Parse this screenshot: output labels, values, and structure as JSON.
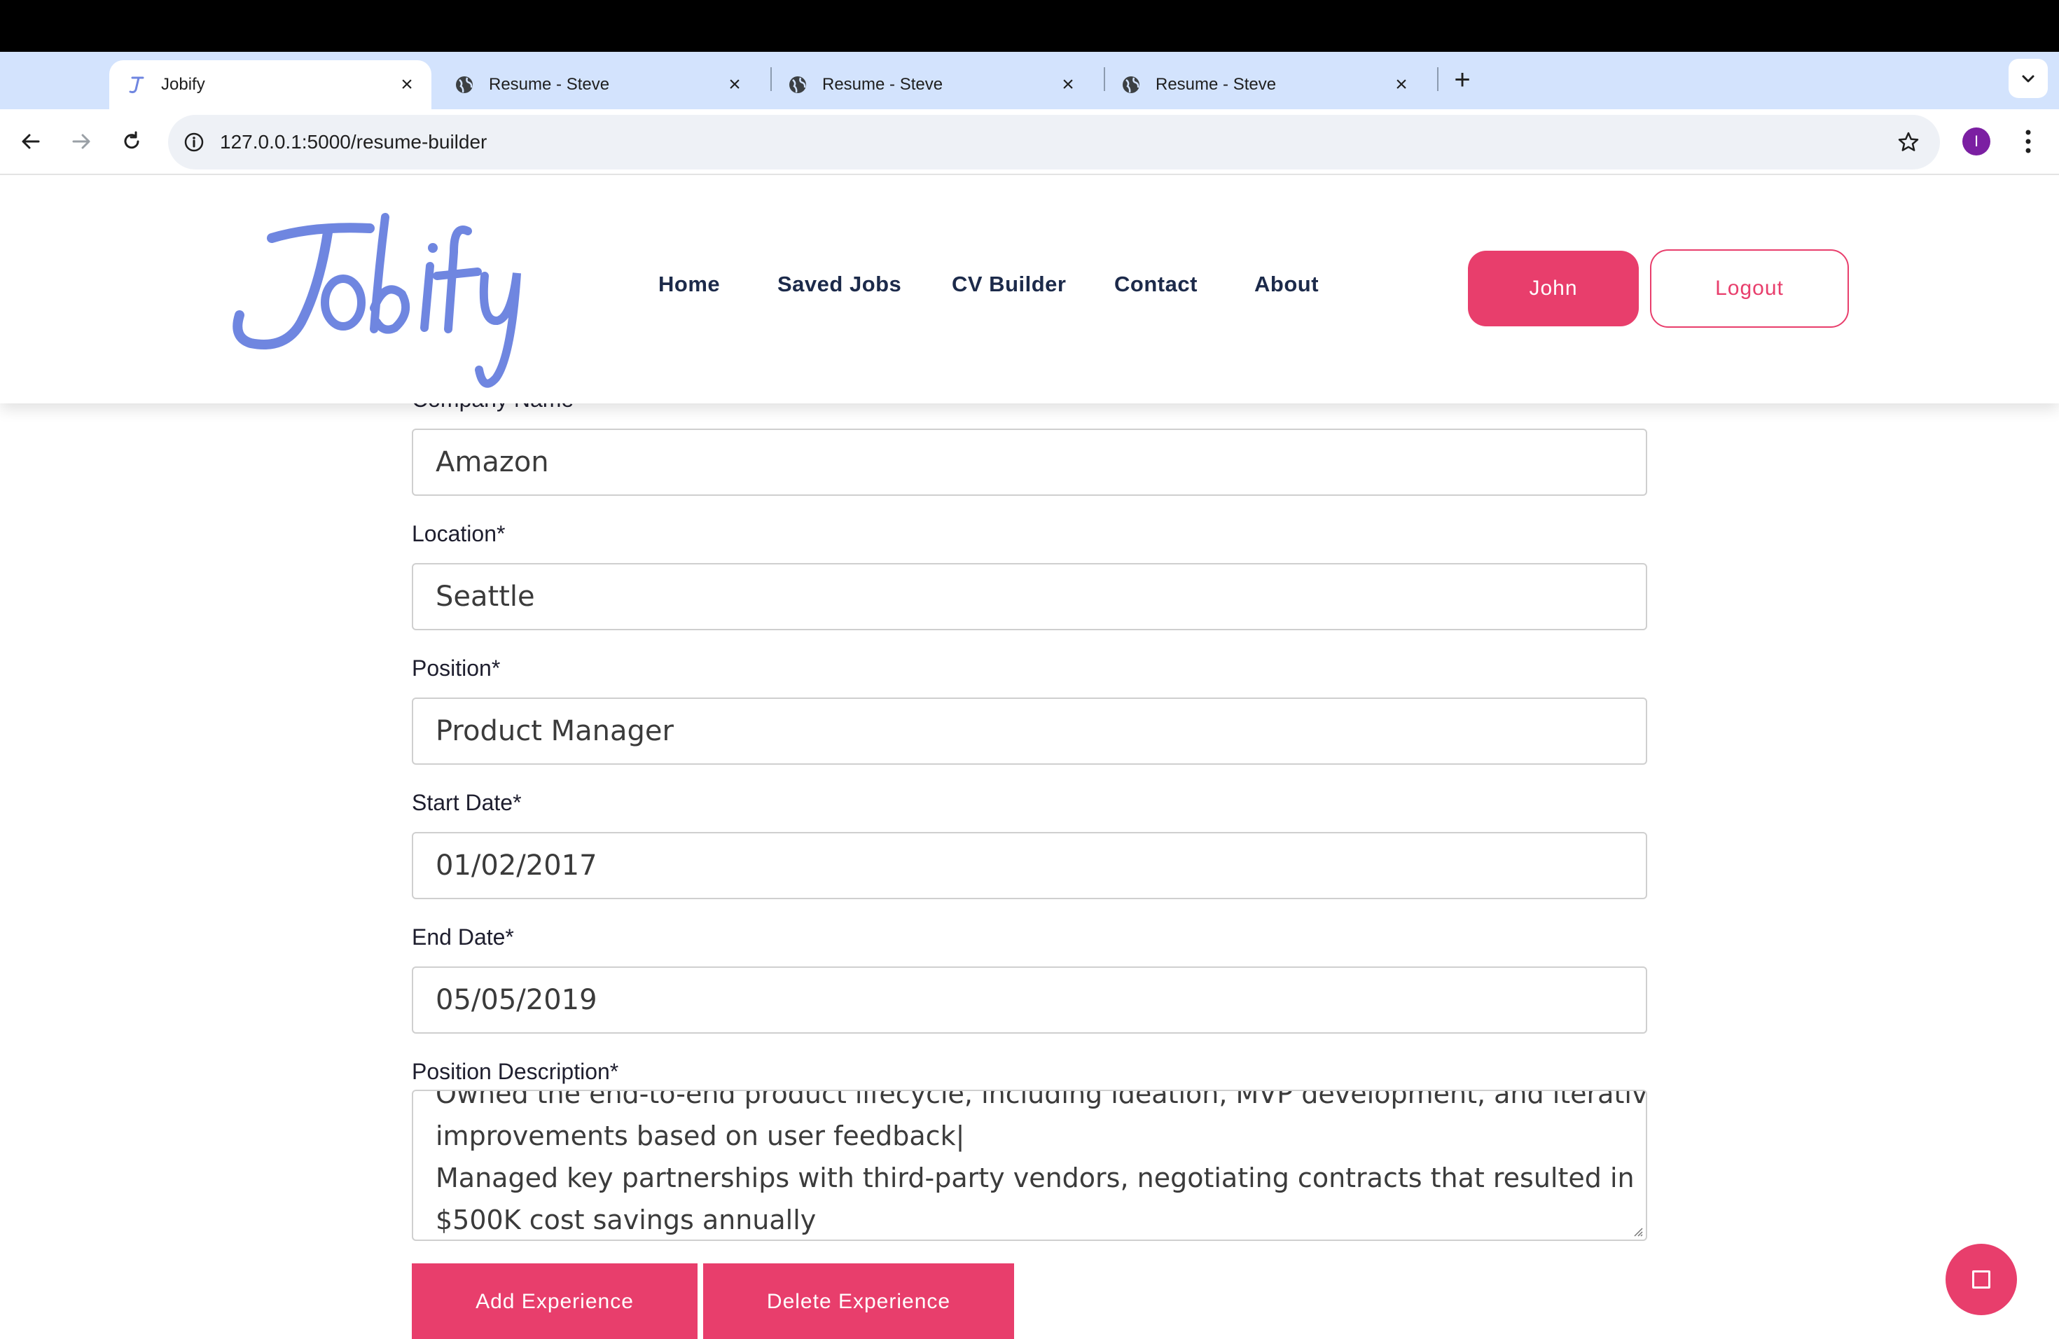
{
  "browser": {
    "tabs": [
      {
        "title": "Jobify",
        "active": true,
        "close_label": "×"
      },
      {
        "title": "Resume - Steve",
        "active": false,
        "close_label": "×"
      },
      {
        "title": "Resume - Steve",
        "active": false,
        "close_label": "×"
      },
      {
        "title": "Resume - Steve",
        "active": false,
        "close_label": "×"
      }
    ],
    "new_tab_label": "+",
    "url": "127.0.0.1:5000/resume-builder",
    "profile_initial": "I"
  },
  "site": {
    "logo_text": "Jobify",
    "nav": [
      "Home",
      "Saved Jobs",
      "CV Builder",
      "Contact",
      "About"
    ],
    "user_button": "John",
    "logout_button": "Logout"
  },
  "form": {
    "company": {
      "label": "Company Name",
      "value": "Amazon"
    },
    "location": {
      "label": "Location*",
      "value": "Seattle"
    },
    "position": {
      "label": "Position*",
      "value": "Product Manager"
    },
    "start_date": {
      "label": "Start Date*",
      "value": "01/02/2017"
    },
    "end_date": {
      "label": "End Date*",
      "value": "05/05/2019"
    },
    "description": {
      "label": "Position Description*",
      "lines": [
        "Owned the end-to-end product lifecycle, including ideation, MVP development, and iterative",
        "improvements based on user feedback|",
        "Managed key partnerships with third-party vendors, negotiating contracts that resulted in",
        "$500K cost savings annually"
      ]
    },
    "add_button": "Add Experience",
    "delete_button": "Delete Experience"
  },
  "colors": {
    "accent": "#e83e6c",
    "logo": "#6f86e0",
    "nav_text": "#1c2a4a"
  },
  "icons": {
    "fab": "stop-square-icon"
  }
}
